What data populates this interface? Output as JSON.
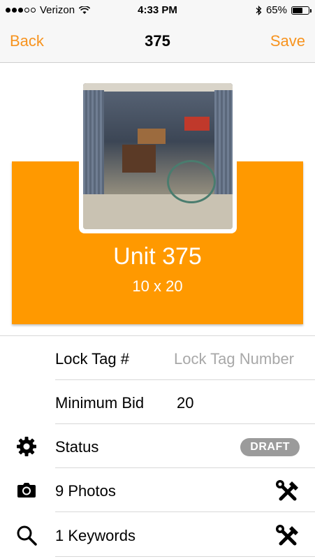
{
  "status_bar": {
    "carrier": "Verizon",
    "time": "4:33 PM",
    "battery": "65%",
    "battery_level": 0.65
  },
  "nav": {
    "back_label": "Back",
    "title": "375",
    "save_label": "Save"
  },
  "unit": {
    "title": "Unit 375",
    "size": "10 x 20"
  },
  "fields": {
    "lock_tag": {
      "label": "Lock Tag #",
      "placeholder": "Lock Tag Number",
      "value": ""
    },
    "minimum_bid": {
      "label": "Minimum Bid",
      "value": "20"
    },
    "status": {
      "label": "Status",
      "badge": "DRAFT"
    },
    "photos": {
      "label": "9 Photos"
    },
    "keywords": {
      "label": "1 Keywords"
    }
  },
  "icons": {
    "status": "gear-icon",
    "photos": "camera-icon",
    "keywords": "search-icon",
    "edit": "tools-icon"
  },
  "colors": {
    "accent": "#f7931e",
    "hero": "#ff9900",
    "badge": "#9b9b9b"
  }
}
